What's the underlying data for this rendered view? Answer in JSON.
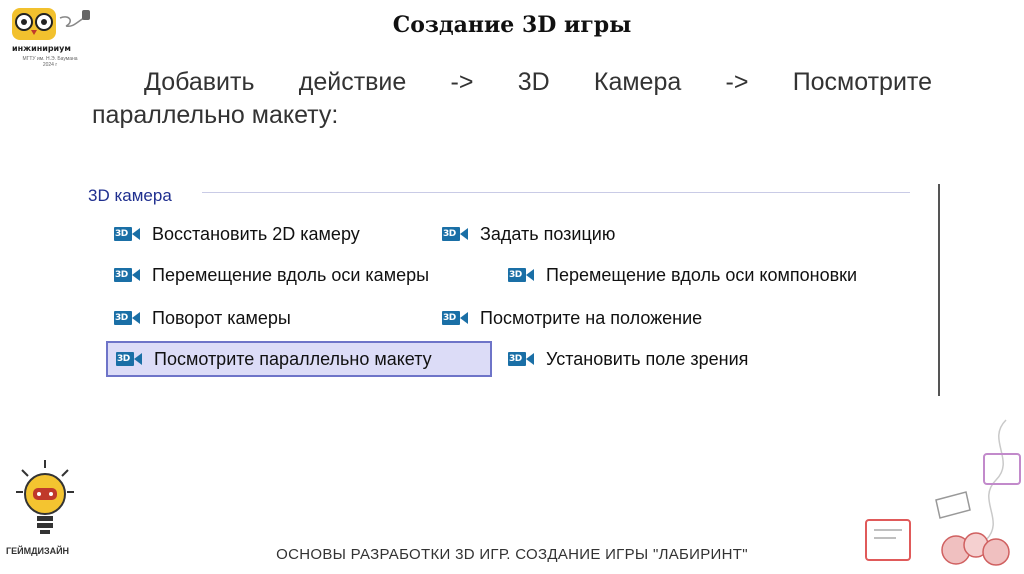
{
  "logo": {
    "name": "инжинириум",
    "subtitle": "МГТУ им. Н.Э. Баумана 2024 г"
  },
  "slide": {
    "title": "Создание 3D игры",
    "intro_line1": [
      "Добавить",
      "действие",
      "->",
      "3D",
      "Камера",
      "->",
      "Посмотрите"
    ],
    "intro_line2": "параллельно макету:"
  },
  "panel": {
    "title": "3D камера",
    "actions": [
      {
        "label": "Восстановить 2D камеру",
        "icon": "3d-camera-icon",
        "selected": false
      },
      {
        "label": "Задать позицию",
        "icon": "3d-camera-icon",
        "selected": false
      },
      {
        "label": "Перемещение вдоль оси камеры",
        "icon": "3d-camera-icon",
        "selected": false
      },
      {
        "label": "Перемещение вдоль оси компоновки",
        "icon": "3d-camera-icon",
        "selected": false
      },
      {
        "label": "Поворот камеры",
        "icon": "3d-camera-icon",
        "selected": false
      },
      {
        "label": "Посмотрите на положение",
        "icon": "3d-camera-icon",
        "selected": false
      },
      {
        "label": "Посмотрите параллельно макету",
        "icon": "3d-camera-icon",
        "selected": true
      },
      {
        "label": "Установить поле зрения",
        "icon": "3d-camera-icon",
        "selected": false
      }
    ],
    "icon_text": "3D"
  },
  "bottom_logo": {
    "caption": "ГЕЙМДИЗАЙН"
  },
  "footer": {
    "text": "ОСНОВЫ РАЗРАБОТКИ 3D ИГР. СОЗДАНИЕ ИГРЫ \"ЛАБИРИНТ\""
  },
  "colors": {
    "accent": "#1f2f8f",
    "icon": "#1a6fa6",
    "selection_bg": "#dcdcf7",
    "selection_border": "#6e74c8"
  }
}
